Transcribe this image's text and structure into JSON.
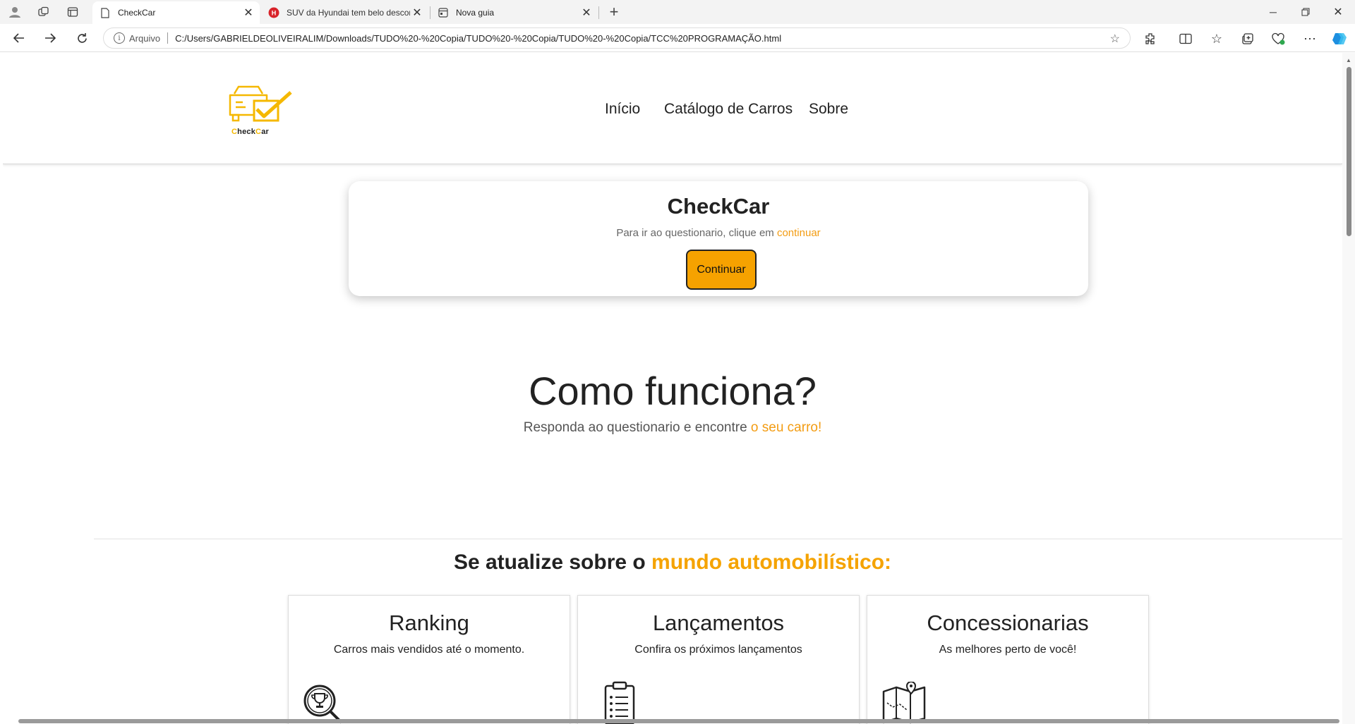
{
  "browser": {
    "tabs": [
      {
        "title": "CheckCar",
        "active": true
      },
      {
        "title": "SUV da Hyundai tem belo descon",
        "active": false
      },
      {
        "title": "Nova guia",
        "active": false
      }
    ],
    "address": {
      "scheme_label": "Arquivo",
      "url": "C:/Users/GABRIELDEOLIVEIRALIM/Downloads/TUDO%20-%20Copia/TUDO%20-%20Copia/TUDO%20-%20Copia/TCC%20PROGRAMAÇÃO.html"
    }
  },
  "site": {
    "logo_text_prefix": "C",
    "logo_text_mid": "heck",
    "logo_text_c": "C",
    "logo_text_end": "ar",
    "nav": [
      "Início",
      "Catálogo de Carros",
      "Sobre"
    ],
    "hero": {
      "title": "CheckCar",
      "sub_text": "Para ir ao questionario, clique em ",
      "sub_link": "continuar",
      "button": "Continuar"
    },
    "how": {
      "title": "Como funciona?",
      "sub_text": "Responda ao questionario e encontre ",
      "sub_link": "o seu carro!"
    },
    "news": {
      "title_text": "Se atualize sobre o ",
      "title_link": "mundo automobilístico:"
    },
    "cards": [
      {
        "title": "Ranking",
        "subtitle": "Carros mais vendidos até o momento.",
        "icon": "trophy-magnifier-icon"
      },
      {
        "title": "Lançamentos",
        "subtitle": "Confira os próximos lançamentos",
        "icon": "clipboard-checklist-icon"
      },
      {
        "title": "Concessionarias",
        "subtitle": "As melhores perto de você!",
        "icon": "map-pin-icon"
      }
    ]
  },
  "colors": {
    "accent": "#f5a300",
    "link": "#f39c12",
    "button": "#f6a200"
  }
}
